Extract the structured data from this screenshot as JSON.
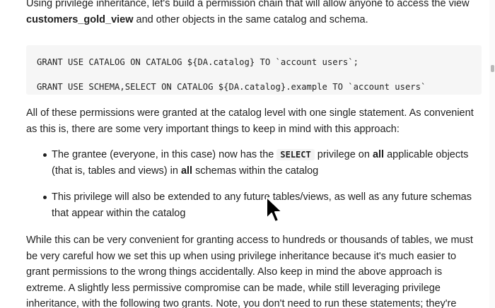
{
  "intro": {
    "line1": "Using privilege inheritance, let's build a permission chain that will allow anyone to access the view",
    "view_name": "customers_gold_view",
    "line2_rest": " and other objects in the same catalog and schema."
  },
  "code": {
    "line1": "GRANT USE CATALOG ON CATALOG ${DA.catalog} TO `account users`;",
    "line2": "GRANT USE SCHEMA,SELECT ON CATALOG ${DA.catalog}.example TO `account users`"
  },
  "para2": {
    "line1": "All of these permissions were granted at the catalog level with one single statement. As convenient",
    "line2": "as this is, there are some very important things to keep in mind with this approach:"
  },
  "bullets": [
    {
      "pre": "The grantee (everyone, in this case) now has the ",
      "code": "SELECT",
      "mid": " privilege on ",
      "bold1": "all",
      "post1": " applicable objects",
      "line2_pre": "(that is, tables and views) in ",
      "bold2": "all",
      "line2_post": " schemas within the catalog"
    },
    {
      "line1": "This privilege will also be extended to any future tables/views, as well as any future schemas",
      "line2": "that appear within the catalog"
    }
  ],
  "para3": {
    "line1": "While this can be very convenient for granting access to hundreds or thousands of tables, we must",
    "line2": "be very careful how we set this up when using privilege inheritance because it's much easier to",
    "line3": "grant permissions to the wrong things accidentally. Also keep in mind the above approach is",
    "line4": "extreme. A slightly less permissive compromise can be made, while still leveraging privilege",
    "line5": "inheritance, with the following two grants. Note, you don't need to run these statements; they're"
  }
}
